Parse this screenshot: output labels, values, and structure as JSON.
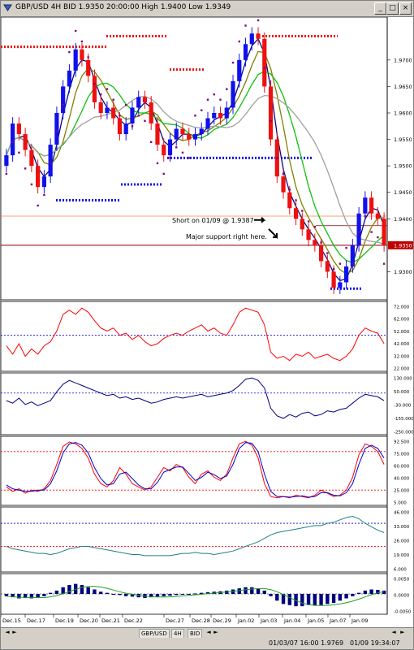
{
  "window": {
    "title": "GBP/USD 4H BID 1.9350 20:00:00 High 1.9400 Low 1.9349",
    "buttons": [
      "_",
      "□",
      "×"
    ]
  },
  "annotations": {
    "short_note": "Short on 01/09 @ 1.9387",
    "support_note": "Major support right here."
  },
  "tabs": {
    "symbol": "GBP/USD",
    "timeframe": "4H",
    "side": "BID",
    "nav": [
      "◄",
      "►",
      "◄",
      "►",
      "◄",
      "►"
    ]
  },
  "status": {
    "left": "01/03/07 16:00 1.9769",
    "right": "01/09 19:34:07"
  },
  "colors": {
    "bull": "#1010ee",
    "bear": "#ee1010",
    "sar": "#7a0a7a",
    "ma_fast": "#0a0a80",
    "ma_mid": "#808000",
    "ma_green": "#10c010",
    "ma_slow": "#a0a0a0",
    "red_line": "#ff0000",
    "blue_line": "#0000cc",
    "teal_line": "#208080"
  },
  "chart_data": [
    {
      "type": "candlestick",
      "panel": "price",
      "xaxis_labels": [
        "Dec.15",
        "Dec.17",
        "Dec.19",
        "Dec.20",
        "Dec.21",
        "Dec.22",
        "Dec.27",
        "Dec.28",
        "Dec.29",
        "Jan.02",
        "Jan.03",
        "Jan.04",
        "Jan.05",
        "Jan.07",
        "Jan.09"
      ],
      "yticks": [
        1.97,
        1.965,
        1.96,
        1.955,
        1.95,
        1.945,
        1.94,
        1.93
      ],
      "ylim": [
        1.925,
        1.9775
      ],
      "price_close": [
        1.952,
        1.958,
        1.956,
        1.953,
        1.95,
        1.946,
        1.948,
        1.954,
        1.96,
        1.965,
        1.968,
        1.972,
        1.97,
        1.967,
        1.962,
        1.96,
        1.961,
        1.959,
        1.956,
        1.958,
        1.961,
        1.963,
        1.962,
        1.958,
        1.954,
        1.952,
        1.955,
        1.957,
        1.956,
        1.955,
        1.956,
        1.957,
        1.959,
        1.96,
        1.959,
        1.961,
        1.966,
        1.97,
        1.973,
        1.975,
        1.974,
        1.965,
        1.955,
        1.948,
        1.945,
        1.942,
        1.94,
        1.938,
        1.936,
        1.935,
        1.932,
        1.93,
        1.927,
        1.928,
        1.931,
        1.935,
        1.941,
        1.944,
        1.941,
        1.94,
        1.935
      ],
      "current_price": 1.935,
      "current_price_label": "1.9350",
      "support_level": 1.935,
      "resistance_level": 1.9405,
      "short_entry": 1.9387,
      "sar_levels": [
        {
          "price": 1.9725,
          "label": "top-left"
        },
        {
          "price": 1.9745,
          "label": "top-mid"
        },
        {
          "price": 1.9682,
          "label": "mid"
        },
        {
          "price": 1.9745,
          "label": "top-right"
        },
        {
          "price": 1.9515,
          "label": "right"
        },
        {
          "price": 1.9465,
          "label": "left-low"
        },
        {
          "price": 1.9435,
          "label": "left-lower"
        },
        {
          "price": 1.9268,
          "label": "bottom"
        }
      ]
    },
    {
      "type": "line",
      "panel": "oscillator_1",
      "yticks": [
        "72.000",
        "62.000",
        "52.000",
        "42.000",
        "32.000",
        "22.000"
      ],
      "ylim": [
        16,
        78
      ],
      "reference": 48,
      "values": [
        38,
        30,
        40,
        28,
        35,
        30,
        38,
        42,
        52,
        68,
        72,
        68,
        74,
        70,
        62,
        55,
        52,
        55,
        48,
        50,
        44,
        48,
        42,
        38,
        40,
        45,
        48,
        50,
        48,
        52,
        55,
        58,
        52,
        55,
        50,
        48,
        58,
        70,
        74,
        72,
        70,
        58,
        32,
        26,
        28,
        24,
        30,
        28,
        32,
        26,
        28,
        30,
        26,
        24,
        28,
        35,
        48,
        55,
        52,
        50,
        40
      ]
    },
    {
      "type": "line",
      "panel": "oscillator_2",
      "yticks": [
        "130.000",
        "50.000",
        "-30.000",
        "-155.000",
        "-250.000"
      ],
      "ylim": [
        -290,
        160
      ],
      "reference": 20,
      "values": [
        -40,
        -60,
        -20,
        -70,
        -50,
        -80,
        -60,
        -40,
        30,
        90,
        120,
        100,
        80,
        60,
        40,
        20,
        0,
        10,
        -20,
        -10,
        -30,
        -20,
        -40,
        -60,
        -50,
        -30,
        -20,
        -10,
        -20,
        -10,
        0,
        10,
        -10,
        0,
        10,
        20,
        40,
        80,
        130,
        140,
        120,
        60,
        -100,
        -160,
        -180,
        -150,
        -170,
        -140,
        -130,
        -160,
        -150,
        -120,
        -130,
        -110,
        -100,
        -60,
        -20,
        10,
        0,
        -10,
        -40
      ]
    },
    {
      "type": "line",
      "panel": "stochastic",
      "yticks": [
        "92.500",
        "75.000",
        "60.000",
        "40.000",
        "25.000",
        "5.000"
      ],
      "ylim": [
        0,
        100
      ],
      "levels": [
        80,
        20
      ],
      "series": [
        {
          "values": [
            25,
            18,
            22,
            15,
            20,
            18,
            22,
            35,
            60,
            88,
            95,
            92,
            85,
            70,
            45,
            30,
            25,
            35,
            55,
            45,
            30,
            25,
            20,
            25,
            40,
            55,
            50,
            60,
            55,
            40,
            30,
            45,
            50,
            40,
            35,
            45,
            70,
            92,
            96,
            90,
            70,
            30,
            10,
            8,
            10,
            8,
            12,
            10,
            8,
            12,
            20,
            15,
            10,
            12,
            20,
            40,
            75,
            92,
            88,
            80,
            60
          ]
        },
        {
          "values": [
            28,
            22,
            20,
            18,
            18,
            20,
            20,
            30,
            50,
            78,
            92,
            94,
            90,
            78,
            55,
            38,
            28,
            30,
            45,
            48,
            38,
            28,
            22,
            22,
            32,
            48,
            52,
            56,
            56,
            46,
            35,
            40,
            48,
            44,
            38,
            42,
            60,
            85,
            94,
            93,
            80,
            45,
            18,
            10,
            10,
            9,
            10,
            11,
            9,
            10,
            16,
            16,
            12,
            11,
            16,
            30,
            60,
            85,
            90,
            85,
            70
          ]
        }
      ]
    },
    {
      "type": "line",
      "panel": "adx",
      "yticks": [
        "46.000",
        "33.000",
        "26.000",
        "19.000",
        "6.000"
      ],
      "ylim": [
        0,
        52
      ],
      "levels": [
        40,
        20
      ],
      "values": [
        20,
        18,
        17,
        16,
        15,
        14,
        14,
        13,
        14,
        16,
        18,
        19,
        20,
        20,
        19,
        18,
        17,
        16,
        15,
        14,
        13,
        13,
        12,
        12,
        12,
        12,
        12,
        13,
        14,
        14,
        15,
        14,
        14,
        13,
        14,
        15,
        16,
        18,
        20,
        22,
        24,
        27,
        30,
        32,
        33,
        34,
        35,
        36,
        37,
        38,
        38,
        40,
        41,
        43,
        45,
        46,
        44,
        40,
        37,
        34,
        32
      ]
    },
    {
      "type": "bar",
      "panel": "histogram",
      "yticks": [
        "0.0050",
        "0.0000",
        "-0.0050"
      ],
      "ylim": [
        -0.008,
        0.008
      ],
      "values": [
        -0.001,
        -0.0015,
        -0.002,
        -0.0018,
        -0.002,
        -0.0015,
        -0.001,
        0.0005,
        0.0015,
        0.003,
        0.004,
        0.0045,
        0.004,
        0.003,
        0.002,
        0.001,
        0.0005,
        0.0,
        -0.0005,
        -0.001,
        -0.0012,
        -0.0015,
        -0.0018,
        -0.0015,
        -0.0012,
        -0.001,
        -0.0008,
        -0.0005,
        -0.0003,
        0.0,
        0.0002,
        0.0005,
        0.0008,
        0.001,
        0.0012,
        0.0015,
        0.002,
        0.0025,
        0.003,
        0.003,
        0.0025,
        0.0015,
        -0.001,
        -0.003,
        -0.0045,
        -0.005,
        -0.0055,
        -0.0055,
        -0.005,
        -0.0052,
        -0.005,
        -0.0045,
        -0.004,
        -0.003,
        -0.002,
        -0.001,
        0.0005,
        0.0015,
        0.002,
        0.0018,
        0.0015
      ]
    }
  ]
}
